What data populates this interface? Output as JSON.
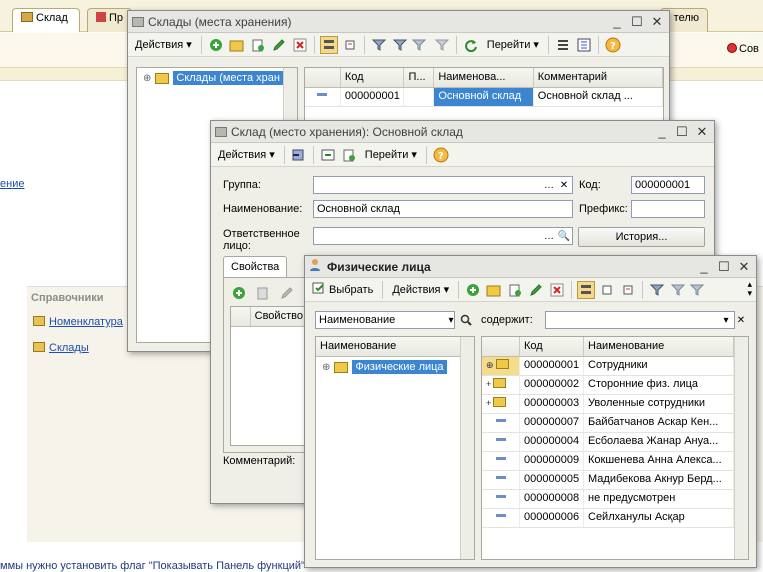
{
  "background": {
    "tabs": [
      {
        "label": "Склад",
        "active": true
      },
      {
        "label": "Пр",
        "active": false
      },
      {
        "label": "телю",
        "active": false
      }
    ],
    "toolbar_right_label": "Сов",
    "left_link": "ение",
    "section_title": "Справочники",
    "links": [
      "Номенклатура",
      "Склады"
    ],
    "status_text": "ммы нужно установить флаг \"Показывать Панель функций\""
  },
  "warehouses_window": {
    "title": "Склады (места хранения)",
    "toolbar": {
      "actions": "Действия",
      "goto": "Перейти"
    },
    "tree_item": "Склады (места хран",
    "columns": [
      "Код",
      "П...",
      "Наименова...",
      "Комментарий"
    ],
    "rows": [
      {
        "code": "000000001",
        "p": "",
        "name": "Основной склад",
        "comment": "Основной склад ..."
      }
    ]
  },
  "warehouse_form": {
    "title": "Склад (место хранения): Основной склад",
    "toolbar": {
      "actions": "Действия",
      "goto": "Перейти"
    },
    "group_label": "Группа:",
    "group_value": "",
    "code_label": "Код:",
    "code_value": "000000001",
    "name_label": "Наименование:",
    "name_value": "Основной склад",
    "prefix_label": "Префикс:",
    "prefix_value": "",
    "responsible_label_1": "Ответственное",
    "responsible_label_2": "лицо:",
    "responsible_value": "",
    "history_button": "История...",
    "tab_properties": "Свойства",
    "props_column": "Свойство",
    "comment_label": "Комментарий:"
  },
  "persons_window": {
    "title": "Физические лица",
    "toolbar": {
      "select": "Выбрать",
      "actions": "Действия"
    },
    "search_field": "Наименование",
    "contains_label": "содержит:",
    "contains_value": "",
    "tree_header": "Наименование",
    "tree_item": "Физические лица",
    "list_columns": {
      "code": "Код",
      "name": "Наименование"
    },
    "rows": [
      {
        "type": "folder-expandable",
        "code": "000000001",
        "name": "Сотрудники"
      },
      {
        "type": "folder",
        "code": "000000002",
        "name": "Сторонние физ. лица"
      },
      {
        "type": "folder",
        "code": "000000003",
        "name": "Уволенные сотрудники"
      },
      {
        "type": "item",
        "code": "000000007",
        "name": "Байбатчанов Аскар Кен..."
      },
      {
        "type": "item",
        "code": "000000004",
        "name": "Есболаева Жанар Ануа..."
      },
      {
        "type": "item",
        "code": "000000009",
        "name": "Кокшенева Анна Алекса..."
      },
      {
        "type": "item",
        "code": "000000005",
        "name": "Мадибекова Акнур Берд..."
      },
      {
        "type": "item",
        "code": "000000008",
        "name": "не предусмотрен"
      },
      {
        "type": "item",
        "code": "000000006",
        "name": "Сейлханулы Асқар"
      }
    ]
  },
  "colors": {
    "selection": "#3c86d1",
    "link": "#1a4eb0",
    "folder": "#f0c94a"
  }
}
